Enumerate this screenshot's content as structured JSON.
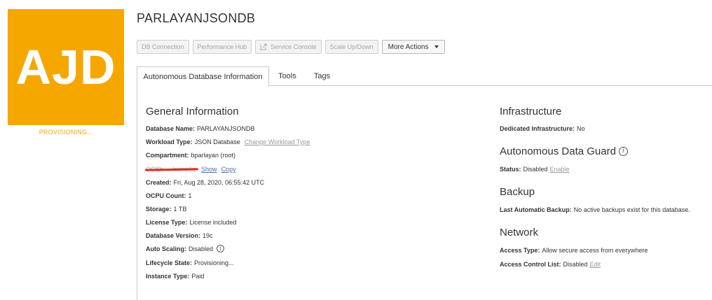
{
  "badge": {
    "text": "AJD",
    "status": "PROVISIONING...",
    "color": "#f5a700"
  },
  "page": {
    "title": "PARLAYANJSONDB"
  },
  "toolbar": {
    "db_connection": "DB Connection",
    "performance_hub": "Performance Hub",
    "service_console": "Service Console",
    "scale": "Scale Up/Down",
    "more_actions": "More Actions"
  },
  "tabs": [
    "Autonomous Database Information",
    "Tools",
    "Tags"
  ],
  "general": {
    "title": "General Information",
    "database_name": {
      "label": "Database Name:",
      "value": "PARLAYANJSONDB"
    },
    "workload_type": {
      "label": "Workload Type:",
      "value": "JSON Database",
      "link": "Change Workload Type"
    },
    "compartment": {
      "label": "Compartment:",
      "value": "bparlayan (root)"
    },
    "ocid": {
      "label": "OCID:",
      "value": "...hame6q",
      "show": "Show",
      "copy": "Copy"
    },
    "created": {
      "label": "Created:",
      "value": "Fri, Aug 28, 2020, 06:55:42 UTC"
    },
    "ocpu_count": {
      "label": "OCPU Count:",
      "value": "1"
    },
    "storage": {
      "label": "Storage:",
      "value": "1 TB"
    },
    "license_type": {
      "label": "License Type:",
      "value": "License included"
    },
    "database_version": {
      "label": "Database Version:",
      "value": "19c"
    },
    "auto_scaling": {
      "label": "Auto Scaling:",
      "value": "Disabled"
    },
    "lifecycle_state": {
      "label": "Lifecycle State:",
      "value": "Provisioning..."
    },
    "instance_type": {
      "label": "Instance Type:",
      "value": "Paid"
    }
  },
  "infrastructure": {
    "title": "Infrastructure",
    "dedicated": {
      "label": "Dedicated Infrastructure:",
      "value": "No"
    }
  },
  "data_guard": {
    "title": "Autonomous Data Guard",
    "status": {
      "label": "Status:",
      "value": "Disabled",
      "link": "Enable"
    }
  },
  "backup": {
    "title": "Backup",
    "last_backup": {
      "label": "Last Automatic Backup:",
      "value": "No active backups exist for this database."
    }
  },
  "network": {
    "title": "Network",
    "access_type": {
      "label": "Access Type:",
      "value": "Allow secure access from everywhere"
    },
    "acl": {
      "label": "Access Control List:",
      "value": "Disabled",
      "link": "Edit"
    }
  }
}
